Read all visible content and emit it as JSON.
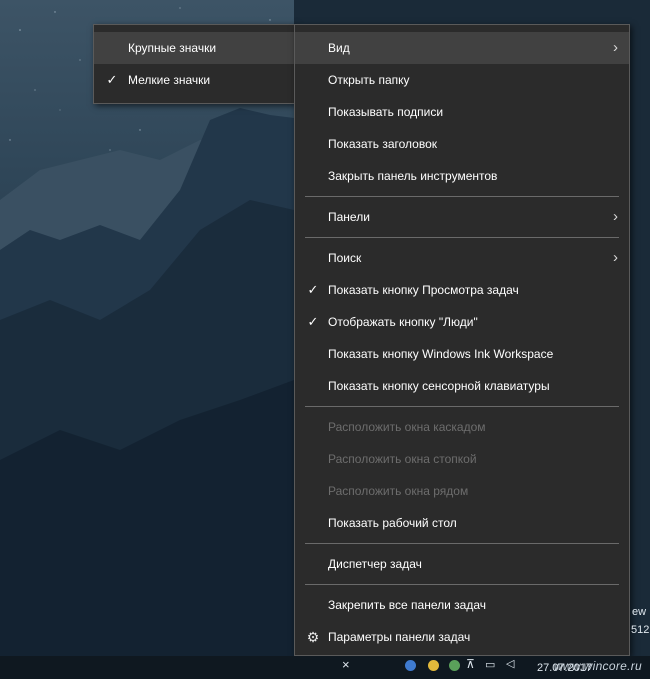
{
  "submenu": {
    "items": [
      {
        "label": "Крупные значки",
        "checked": false,
        "highlighted": true
      },
      {
        "label": "Мелкие значки",
        "checked": true,
        "highlighted": false
      }
    ]
  },
  "menu": {
    "groups": [
      [
        {
          "label": "Вид",
          "has_submenu": true,
          "highlighted": true
        },
        {
          "label": "Открыть папку"
        },
        {
          "label": "Показывать подписи"
        },
        {
          "label": "Показать заголовок"
        },
        {
          "label": "Закрыть панель инструментов"
        }
      ],
      [
        {
          "label": "Панели",
          "has_submenu": true
        }
      ],
      [
        {
          "label": "Поиск",
          "has_submenu": true
        },
        {
          "label": "Показать кнопку Просмотра задач",
          "checked": true
        },
        {
          "label": "Отображать кнопку \"Люди\"",
          "checked": true
        },
        {
          "label": "Показать кнопку Windows Ink Workspace"
        },
        {
          "label": "Показать кнопку сенсорной клавиатуры"
        }
      ],
      [
        {
          "label": "Расположить окна каскадом",
          "disabled": true
        },
        {
          "label": "Расположить окна стопкой",
          "disabled": true
        },
        {
          "label": "Расположить окна рядом",
          "disabled": true
        },
        {
          "label": "Показать рабочий стол"
        }
      ],
      [
        {
          "label": "Диспетчер задач"
        }
      ],
      [
        {
          "label": "Закрепить все панели задач"
        },
        {
          "label": "Параметры панели задач",
          "icon": "gear-icon"
        }
      ]
    ]
  },
  "taskbar": {
    "date": "27.07.2017",
    "watermark": "www.wincore.ru",
    "edge_text_1": "ew",
    "edge_text_2": "512"
  }
}
